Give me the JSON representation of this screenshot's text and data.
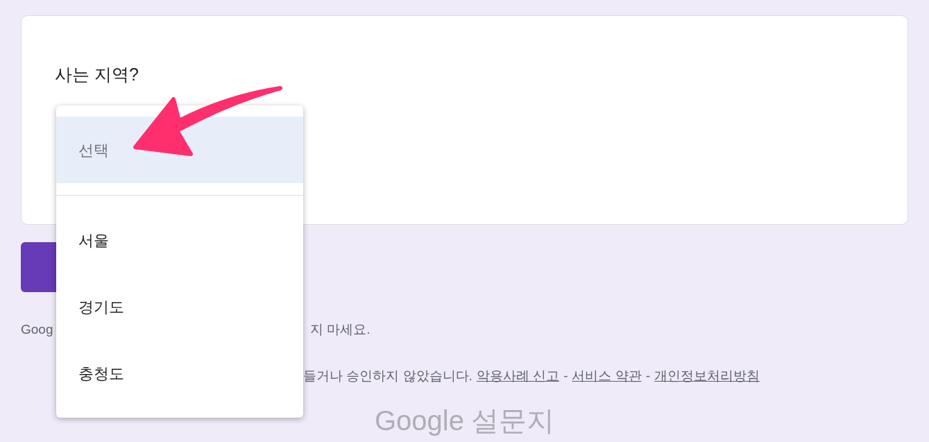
{
  "question": {
    "title": "사는 지역?"
  },
  "dropdown_menu": {
    "options": [
      {
        "label": "선택",
        "kind": "placeholder",
        "selected": true
      },
      {
        "label": "서울",
        "kind": "option",
        "selected": false
      },
      {
        "label": "경기도",
        "kind": "option",
        "selected": false
      },
      {
        "label": "충청도",
        "kind": "option",
        "selected": false
      }
    ]
  },
  "footer": {
    "notice_fragments": [
      "Goog",
      "지 마세요."
    ],
    "disclaimer_fragment": "들거나 승인하지 않았습니다.",
    "links": [
      "악용사례 신고",
      "서비스 약관",
      "개인정보처리방침"
    ],
    "separators": [
      "-",
      "-"
    ]
  },
  "logo": {
    "brand": "Google",
    "product": "설문지"
  }
}
